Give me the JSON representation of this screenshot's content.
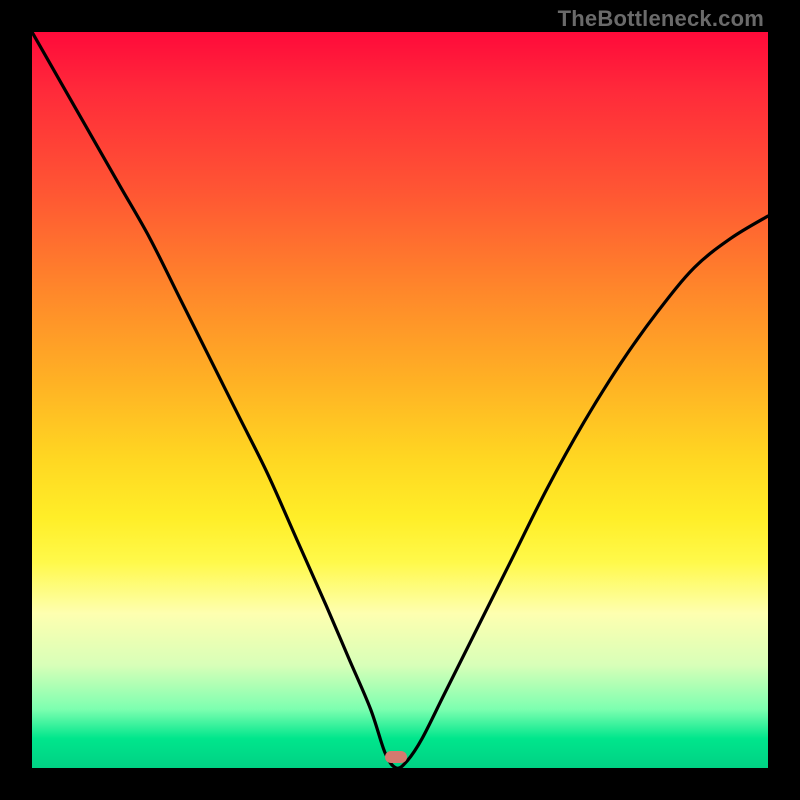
{
  "watermark": "TheBottleneck.com",
  "colors": {
    "frame": "#000000",
    "curve": "#000000",
    "marker": "#d47a6f"
  },
  "marker": {
    "x_pct": 49.5,
    "y_pct": 98.5
  },
  "chart_data": {
    "type": "line",
    "title": "",
    "xlabel": "",
    "ylabel": "",
    "xlim": [
      0,
      100
    ],
    "ylim": [
      0,
      100
    ],
    "grid": false,
    "legend": false,
    "annotations": [
      "TheBottleneck.com"
    ],
    "series": [
      {
        "name": "bottleneck-curve",
        "x": [
          0,
          4,
          8,
          12,
          16,
          20,
          24,
          28,
          32,
          36,
          40,
          43,
          46,
          48,
          49.5,
          51,
          53,
          56,
          60,
          65,
          70,
          75,
          80,
          85,
          90,
          95,
          100
        ],
        "y": [
          100,
          93,
          86,
          79,
          72,
          64,
          56,
          48,
          40,
          31,
          22,
          15,
          8,
          2,
          0,
          1,
          4,
          10,
          18,
          28,
          38,
          47,
          55,
          62,
          68,
          72,
          75
        ]
      }
    ],
    "minimum_point": {
      "x": 49.5,
      "y": 0
    },
    "background_gradient": {
      "orientation": "vertical",
      "stops": [
        {
          "pct": 0,
          "color": "#ff0a3a"
        },
        {
          "pct": 22,
          "color": "#ff5733"
        },
        {
          "pct": 48,
          "color": "#ffb324"
        },
        {
          "pct": 72,
          "color": "#fff94a"
        },
        {
          "pct": 86,
          "color": "#d8ffb8"
        },
        {
          "pct": 100,
          "color": "#00d184"
        }
      ]
    }
  }
}
